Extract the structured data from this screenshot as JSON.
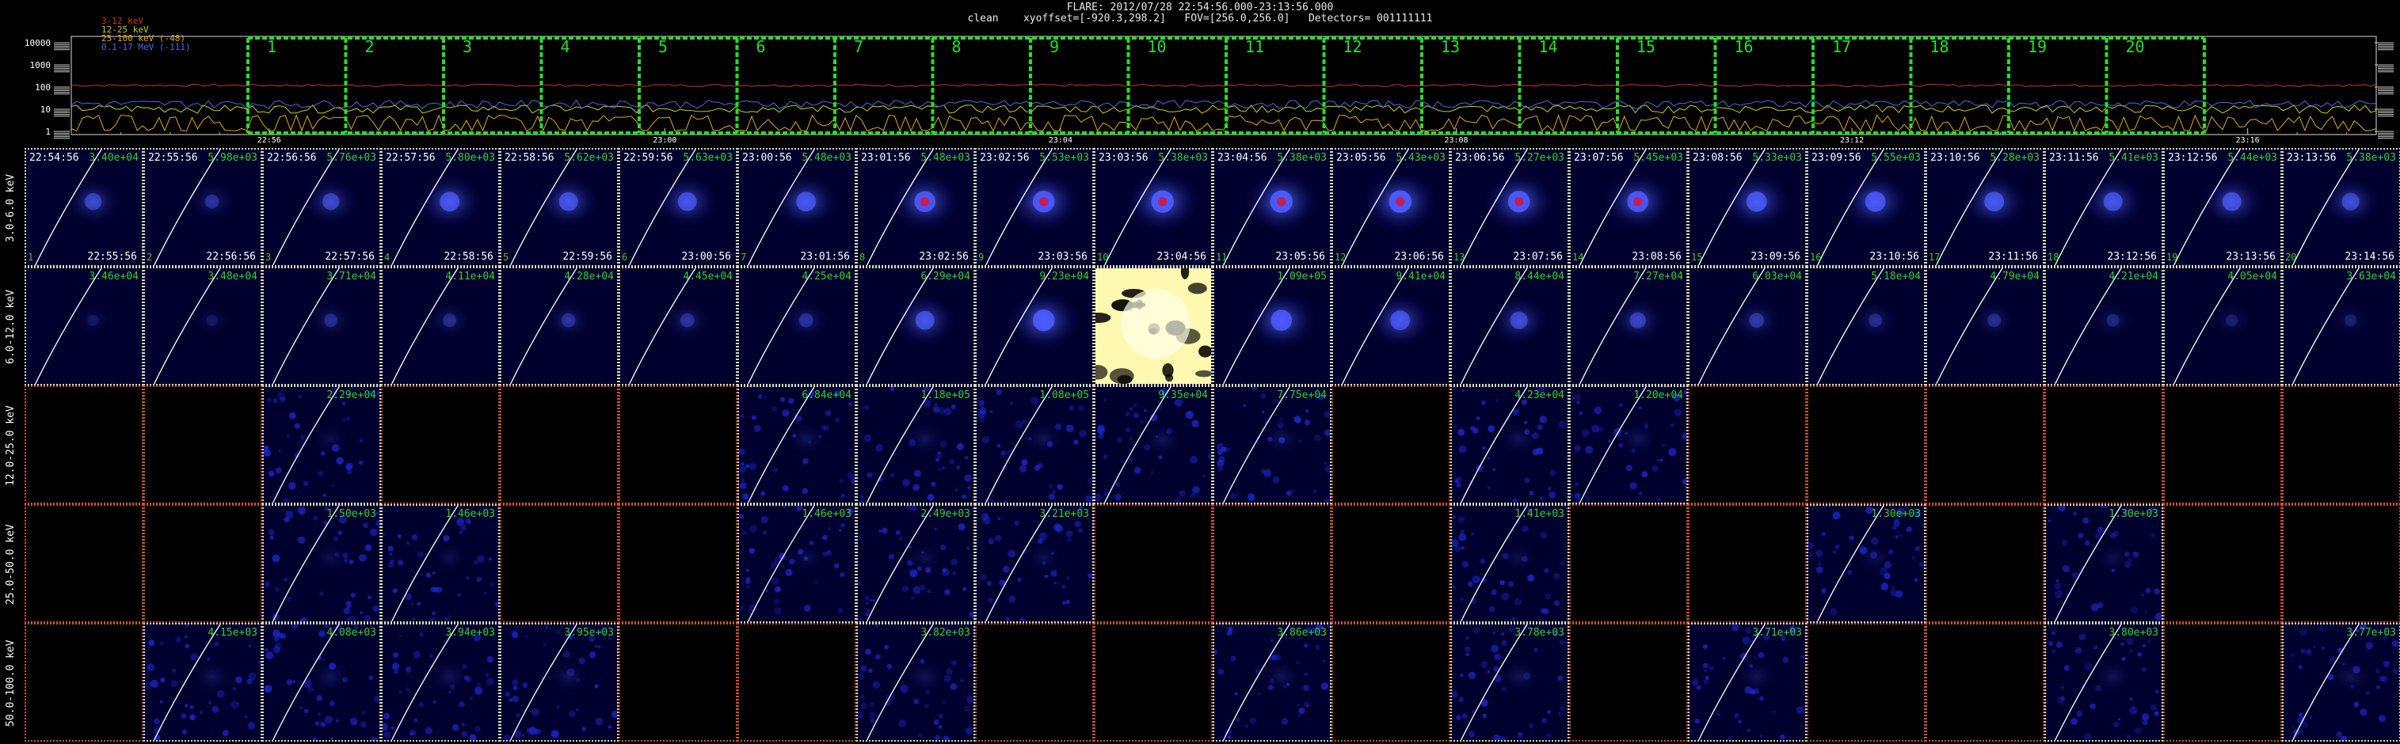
{
  "header": {
    "line1": "FLARE: 2012/07/28 22:54:56.000-23:13:56.000",
    "line2": "clean    xyoffset=[-920.3,298.2]   FOV=[256.0,256.0]   Detectors= 001111111"
  },
  "chart_data": [
    {
      "type": "line",
      "title": "",
      "y_tick_labels": [
        "10000",
        "1000",
        "100",
        "10",
        "1"
      ],
      "yscale": "log",
      "ylim": [
        1,
        10000
      ],
      "x_tick_labels": [
        "22:56",
        "23:00",
        "23:04",
        "23:08",
        "23:12",
        "23:16"
      ],
      "legend": [
        {
          "label": "3-12 keV",
          "color": "#d62d20"
        },
        {
          "label": "12-25 keV",
          "color": "#c8d000"
        },
        {
          "label": "25-100 keV (-48)",
          "color": "#e6a800"
        },
        {
          "label": "0.1-17 MeV (-111)",
          "color": "#3b6ef0"
        }
      ],
      "series": [
        {
          "name": "3-12 keV",
          "color": "#d62d20",
          "level": 120
        },
        {
          "name": "12-25 keV",
          "color": "#c8d000",
          "level": 11
        },
        {
          "name": "25-100 keV (-48)",
          "color": "#e6a800",
          "level": 3
        },
        {
          "name": "0.1-17 MeV (-111)",
          "color": "#3b6ef0",
          "level": 18
        }
      ],
      "interval_labels": [
        "1",
        "2",
        "3",
        "4",
        "5",
        "6",
        "7",
        "8",
        "9",
        "10",
        "11",
        "12",
        "13",
        "14",
        "15",
        "16",
        "17",
        "18",
        "19",
        "20"
      ]
    },
    {
      "type": "heatmap",
      "rows": [
        {
          "label": "3.0-6.0 keV",
          "cells": [
            {
              "start": "22:54:56",
              "end": "22:55:56",
              "peak": "3.40e+04",
              "num": "1",
              "b": 0.55,
              "core": 0
            },
            {
              "start": "22:55:56",
              "end": "22:56:56",
              "peak": "5.98e+03",
              "num": "2",
              "b": 0.35,
              "core": 0
            },
            {
              "start": "22:56:56",
              "end": "22:57:56",
              "peak": "5.76e+03",
              "num": "3",
              "b": 0.55,
              "core": 0
            },
            {
              "start": "22:57:56",
              "end": "22:58:56",
              "peak": "5.80e+03",
              "num": "4",
              "b": 0.75,
              "core": 0
            },
            {
              "start": "22:58:56",
              "end": "22:59:56",
              "peak": "5.62e+03",
              "num": "5",
              "b": 0.7,
              "core": 0
            },
            {
              "start": "22:59:56",
              "end": "23:00:56",
              "peak": "5.63e+03",
              "num": "6",
              "b": 0.7,
              "core": 0
            },
            {
              "start": "23:00:56",
              "end": "23:01:56",
              "peak": "5.48e+03",
              "num": "7",
              "b": 0.75,
              "core": 0
            },
            {
              "start": "23:01:56",
              "end": "23:02:56",
              "peak": "5.48e+03",
              "num": "8",
              "b": 0.85,
              "core": 1
            },
            {
              "start": "23:02:56",
              "end": "23:03:56",
              "peak": "5.53e+03",
              "num": "9",
              "b": 0.9,
              "core": 1
            },
            {
              "start": "23:03:56",
              "end": "23:04:56",
              "peak": "5.38e+03",
              "num": "10",
              "b": 0.95,
              "core": 1
            },
            {
              "start": "23:04:56",
              "end": "23:05:56",
              "peak": "5.38e+03",
              "num": "11",
              "b": 0.95,
              "core": 1
            },
            {
              "start": "23:05:56",
              "end": "23:06:56",
              "peak": "5.43e+03",
              "num": "12",
              "b": 0.95,
              "core": 1
            },
            {
              "start": "23:06:56",
              "end": "23:07:56",
              "peak": "5.27e+03",
              "num": "13",
              "b": 0.9,
              "core": 1
            },
            {
              "start": "23:07:56",
              "end": "23:08:56",
              "peak": "5.45e+03",
              "num": "14",
              "b": 0.85,
              "core": 1
            },
            {
              "start": "23:08:56",
              "end": "23:09:56",
              "peak": "5.33e+03",
              "num": "15",
              "b": 0.8,
              "core": 0
            },
            {
              "start": "23:09:56",
              "end": "23:10:56",
              "peak": "5.55e+03",
              "num": "16",
              "b": 0.8,
              "core": 0
            },
            {
              "start": "23:10:56",
              "end": "23:11:56",
              "peak": "5.28e+03",
              "num": "17",
              "b": 0.75,
              "core": 0
            },
            {
              "start": "23:11:56",
              "end": "23:12:56",
              "peak": "5.41e+03",
              "num": "18",
              "b": 0.7,
              "core": 0
            },
            {
              "start": "23:12:56",
              "end": "23:13:56",
              "peak": "5.44e+03",
              "num": "19",
              "b": 0.7,
              "core": 0
            },
            {
              "start": "23:13:56",
              "end": "23:14:56",
              "peak": "5.38e+03",
              "num": "20",
              "b": 0.6,
              "core": 0
            }
          ]
        },
        {
          "label": "6.0-12.0 keV",
          "cells": [
            {
              "peak": "3.46e+04",
              "b": 0.15
            },
            {
              "peak": "3.48e+04",
              "b": 0.15
            },
            {
              "peak": "3.71e+04",
              "b": 0.3
            },
            {
              "peak": "4.11e+04",
              "b": 0.3
            },
            {
              "peak": "4.28e+04",
              "b": 0.35
            },
            {
              "peak": "4.45e+04",
              "b": 0.35
            },
            {
              "peak": "4.25e+04",
              "b": 0.35
            },
            {
              "peak": "6.29e+04",
              "b": 0.7
            },
            {
              "peak": "9.23e+04",
              "b": 0.9
            },
            {
              "peak": "",
              "b": 0,
              "special": "yellow"
            },
            {
              "peak": "1.09e+05",
              "b": 0.85
            },
            {
              "peak": "9.41e+04",
              "b": 0.75
            },
            {
              "peak": "8.44e+04",
              "b": 0.6
            },
            {
              "peak": "7.27e+04",
              "b": 0.5
            },
            {
              "peak": "6.03e+04",
              "b": 0.4
            },
            {
              "peak": "5.18e+04",
              "b": 0.3
            },
            {
              "peak": "4.79e+04",
              "b": 0.3
            },
            {
              "peak": "4.21e+04",
              "b": 0.25
            },
            {
              "peak": "4.05e+04",
              "b": 0.2
            },
            {
              "peak": "3.63e+04",
              "b": 0.2
            }
          ]
        },
        {
          "label": "12.0-25.0 keV",
          "cells": [
            {
              "blank": 1
            },
            {
              "blank": 1
            },
            {
              "peak": "2.29e+04",
              "b": 0.15
            },
            {
              "blank": 1
            },
            {
              "blank": 1
            },
            {
              "blank": 1
            },
            {
              "peak": "6.84e+04",
              "b": 0.2
            },
            {
              "peak": "1.18e+05",
              "b": 0.2
            },
            {
              "peak": "1.08e+05",
              "b": 0.2
            },
            {
              "peak": "9.35e+04",
              "b": 0.2
            },
            {
              "peak": "7.75e+04",
              "b": 0.2
            },
            {
              "blank": 1
            },
            {
              "peak": "4.23e+04",
              "b": 0.2
            },
            {
              "peak": "1.20e+04",
              "b": 0.2
            },
            {
              "blank": 1
            },
            {
              "blank": 1
            },
            {
              "blank": 1
            },
            {
              "blank": 1
            },
            {
              "blank": 1
            },
            {
              "blank": 1
            }
          ]
        },
        {
          "label": "25.0-50.0 keV",
          "cells": [
            {
              "blank": 1
            },
            {
              "blank": 1
            },
            {
              "peak": "1.50e+03",
              "b": 0.15
            },
            {
              "peak": "1.46e+03",
              "b": 0.15
            },
            {
              "blank": 1
            },
            {
              "blank": 1
            },
            {
              "peak": "1.46e+03",
              "b": 0.15
            },
            {
              "peak": "2.49e+03",
              "b": 0.15
            },
            {
              "peak": "3.21e+03",
              "b": 0.15
            },
            {
              "blank": 1
            },
            {
              "blank": 1
            },
            {
              "blank": 1
            },
            {
              "peak": "1.41e+03",
              "b": 0.15
            },
            {
              "blank": 1
            },
            {
              "blank": 1
            },
            {
              "peak": "1.30e+03",
              "b": 0.15
            },
            {
              "blank": 1
            },
            {
              "peak": "1.30e+03",
              "b": 0.15
            },
            {
              "blank": 1
            },
            {
              "blank": 1
            }
          ]
        },
        {
          "label": "50.0-100.0 keV",
          "cells": [
            {
              "blank": 1
            },
            {
              "peak": "4.15e+03",
              "b": 0.2
            },
            {
              "peak": "4.08e+03",
              "b": 0.2
            },
            {
              "peak": "3.94e+03",
              "b": 0.2
            },
            {
              "peak": "3.95e+03",
              "b": 0.2
            },
            {
              "blank": 1
            },
            {
              "blank": 1
            },
            {
              "peak": "3.82e+03",
              "b": 0.2
            },
            {
              "blank": 1
            },
            {
              "blank": 1
            },
            {
              "peak": "3.86e+03",
              "b": 0.2
            },
            {
              "blank": 1
            },
            {
              "peak": "3.78e+03",
              "b": 0.2
            },
            {
              "blank": 1
            },
            {
              "peak": "3.71e+03",
              "b": 0.2
            },
            {
              "blank": 1
            },
            {
              "blank": 1
            },
            {
              "peak": "3.80e+03",
              "b": 0.2
            },
            {
              "blank": 1
            },
            {
              "peak": "3.77e+03",
              "b": 0.2
            }
          ]
        }
      ]
    }
  ]
}
